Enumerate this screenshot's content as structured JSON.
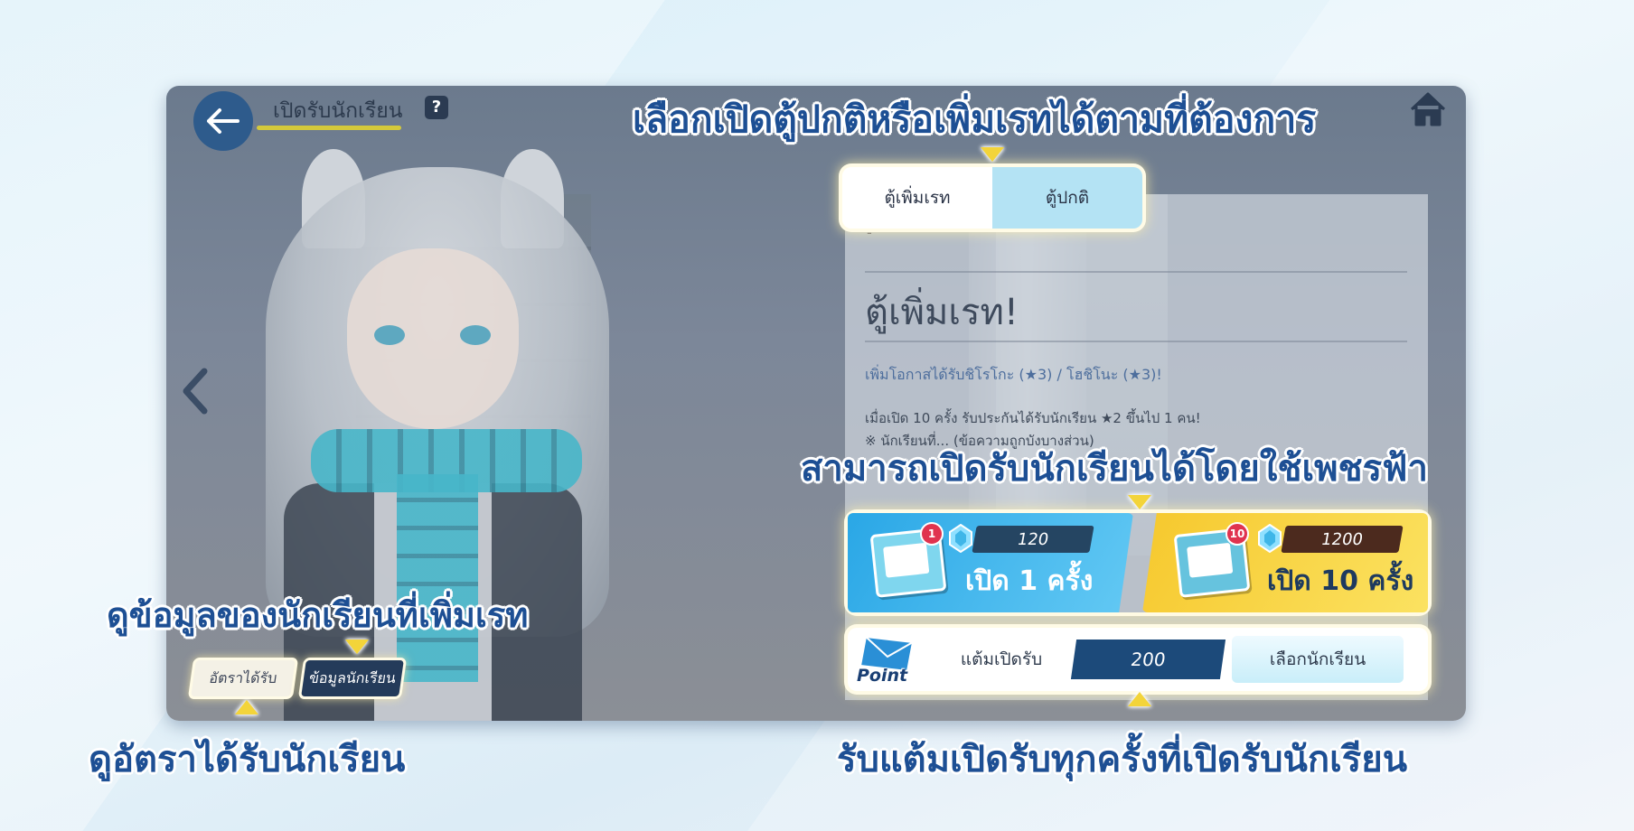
{
  "screen": {
    "title": "เปิดรับนักเรียน",
    "help_label": "?"
  },
  "banner_tabs": [
    {
      "label": "ตู้เพิ่มเรท",
      "active": true
    },
    {
      "label": "ตู้ปกติ",
      "active": false
    }
  ],
  "banner_info": {
    "dash": "-",
    "headline": "ตู้เพิ่มเรท!",
    "rate_up_line": "เพิ่มโอกาสได้รับชิโรโกะ (★3) / โฮชิโนะ (★3)!",
    "guarantee_line": "เมื่อเปิด 10 ครั้ง รับประกันได้รับนักเรียน ★2 ขึ้นไป 1 คน!",
    "note_line": "※ นักเรียนที่... (ข้อความถูกบังบางส่วน)"
  },
  "pulls": [
    {
      "label": "เปิด 1 ครั้ง",
      "cost": "120",
      "badge": "1",
      "color": "#2aa7e6"
    },
    {
      "label": "เปิด 10 ครั้ง",
      "cost": "1200",
      "badge": "10",
      "color": "#f6c82d"
    }
  ],
  "points": {
    "logo_text": "Point",
    "label": "แต้มเปิดรับ",
    "value": "200",
    "select_label": "เลือกนักเรียน"
  },
  "bottom_buttons": {
    "rates": "อัตราได้รับ",
    "student_info": "ข้อมูลนักเรียน"
  },
  "callouts": {
    "tabs": "เลือกเปิดตู้ปกติหรือเพิ่มเรทได้ตามที่ต้องการ",
    "pyroxene": "สามารถเปิดรับนักเรียนได้โดยใช้เพชรฟ้า",
    "student_info": "ดูข้อมูลของนักเรียนที่เพิ่มเรท",
    "rates": "ดูอัตราได้รับนักเรียน",
    "points": "รับแต้มเปิดรับทุกครั้งที่เปิดรับนักเรียน"
  },
  "colors": {
    "callout_text": "#1d4f94",
    "arrow": "#f3d43a",
    "accent_blue": "#1c4a7a"
  },
  "icons": [
    "back-arrow-icon",
    "help-icon",
    "home-icon",
    "left-chevron-icon",
    "mail-icon",
    "pyroxene-gem-icon",
    "point-envelope-icon"
  ]
}
